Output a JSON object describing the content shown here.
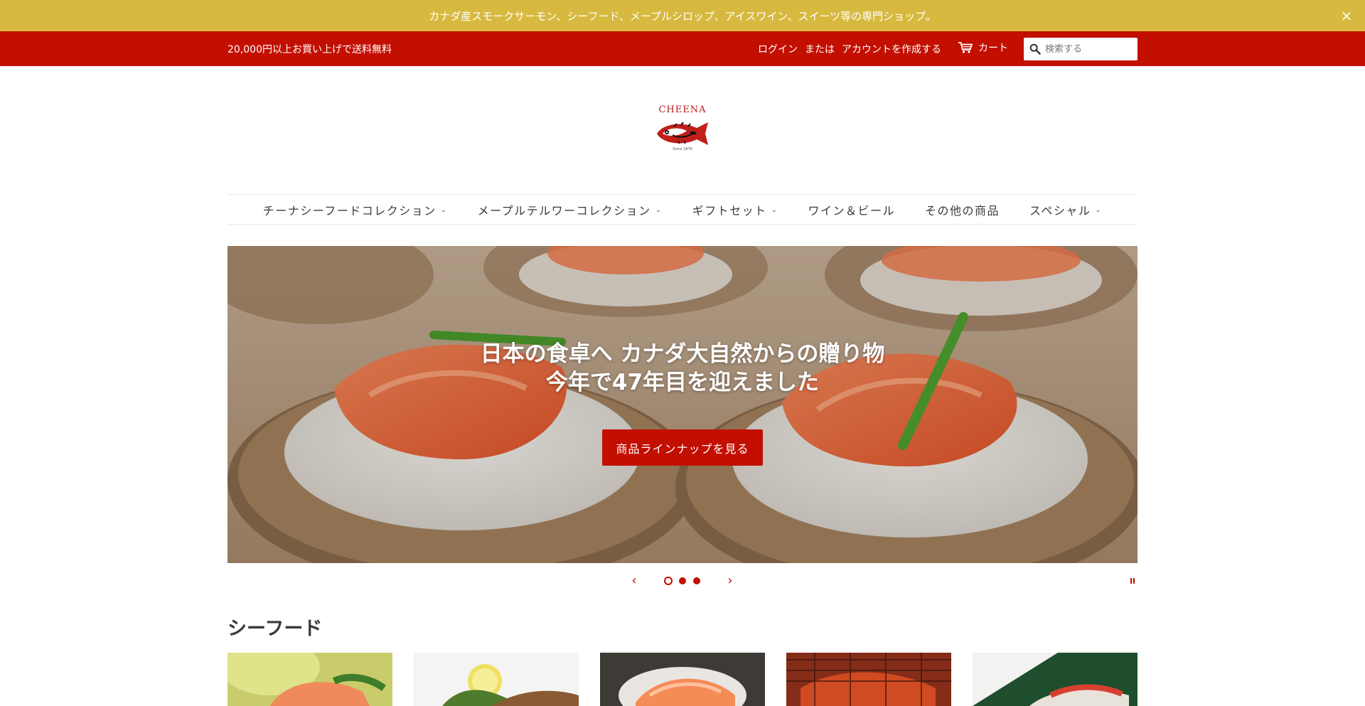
{
  "announcement": {
    "text": "カナダ産スモークサーモン、シーフード、メープルシロップ、アイスワイン、スイーツ等の専門ショップ。",
    "close_icon": "×"
  },
  "topbar": {
    "shipping": "20,000円以上お買い上げで送料無料",
    "login": "ログイン",
    "or": "または",
    "create_account": "アカウントを作成する",
    "cart": "カート",
    "cart_icon": "cart-icon",
    "search_placeholder": "検索する",
    "search_icon": "search-icon"
  },
  "logo": {
    "wordmark": "CHEENA",
    "tagline": "Since 1976"
  },
  "nav": {
    "items": [
      {
        "label": "チーナシーフードコレクション",
        "has_dropdown": true
      },
      {
        "label": "メープルテルワーコレクション",
        "has_dropdown": true
      },
      {
        "label": "ギフトセット",
        "has_dropdown": true
      },
      {
        "label": "ワイン＆ビール",
        "has_dropdown": false
      },
      {
        "label": "その他の商品",
        "has_dropdown": false
      },
      {
        "label": "スペシャル",
        "has_dropdown": true
      }
    ]
  },
  "hero": {
    "title_line1": "日本の食卓へ カナダ大自然からの贈り物",
    "title_line2": "今年で47年目を迎えました",
    "button": "商品ラインナップを見る"
  },
  "slider": {
    "slide_count": 3,
    "active_index": 0,
    "prev_icon": "‹",
    "next_icon": "›"
  },
  "sections": {
    "seafood_title": "シーフード"
  },
  "colors": {
    "announcement_bg": "#d7b93f",
    "topbar_bg": "#c20f00",
    "accent": "#c20f00",
    "text": "#3a3a3a"
  }
}
